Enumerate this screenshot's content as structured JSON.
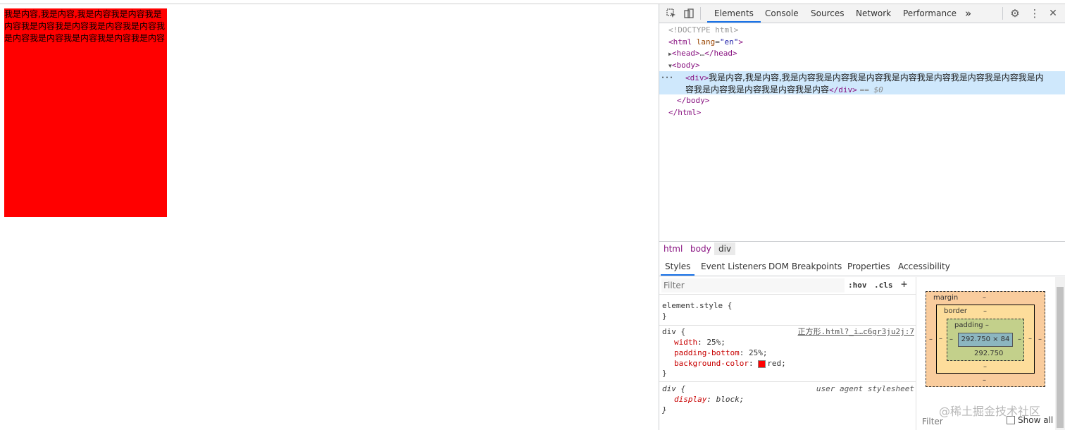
{
  "page": {
    "div_text": "我是内容,我是内容,我是内容我是内容我是内容我是内容我是内容我是内容我是内容我是内容我是内容我是内容我是内容我是内容"
  },
  "devtools": {
    "tabs": [
      "Elements",
      "Console",
      "Sources",
      "Network",
      "Performance"
    ],
    "more": "»",
    "dom": {
      "doctype": "<!DOCTYPE html>",
      "html_open_tag": "html",
      "lang_attr": "lang",
      "lang_val": "\"en\"",
      "head": "head",
      "head_ellipsis": "…",
      "body_open": "<body>",
      "div_open": "<div>",
      "div_text_line1": "我是内容,我是内容,我是内容我是内容我是内容我是内容我是内容我是内容我是内容我是内",
      "div_text_line2": "容我是内容我是内容我是内容我是内容",
      "div_close": "</div>",
      "dollar": "== $0",
      "body_close": "</body>",
      "html_close": "</html>"
    },
    "breadcrumbs": [
      "html",
      "body",
      "div"
    ],
    "subtabs": [
      "Styles",
      "Event Listeners",
      "DOM Breakpoints",
      "Properties",
      "Accessibility"
    ],
    "styles": {
      "filter_placeholder": "Filter",
      "hov": ":hov",
      "cls": ".cls",
      "plus": "+",
      "element_style": "element.style {",
      "close_brace": "}",
      "div_selector": "div {",
      "div_source": "正方形.html?_i…c6gr3ju2j:7",
      "props": [
        {
          "name": "width",
          "value": "25%;"
        },
        {
          "name": "padding-bottom",
          "value": "25%;"
        },
        {
          "name": "background-color",
          "value": "red;"
        }
      ],
      "ua_selector": "div {",
      "ua_source": "user agent stylesheet",
      "ua_prop_name": "display",
      "ua_prop_value": "block;"
    },
    "boxmodel": {
      "margin": "margin",
      "border": "border",
      "padding": "padding –",
      "dash": "–",
      "content_size": "292.750 × 84",
      "padding_bottom": "292.750",
      "filter": "Filter",
      "show_all": "Show all"
    }
  },
  "watermark": "@稀土掘金技术社区"
}
